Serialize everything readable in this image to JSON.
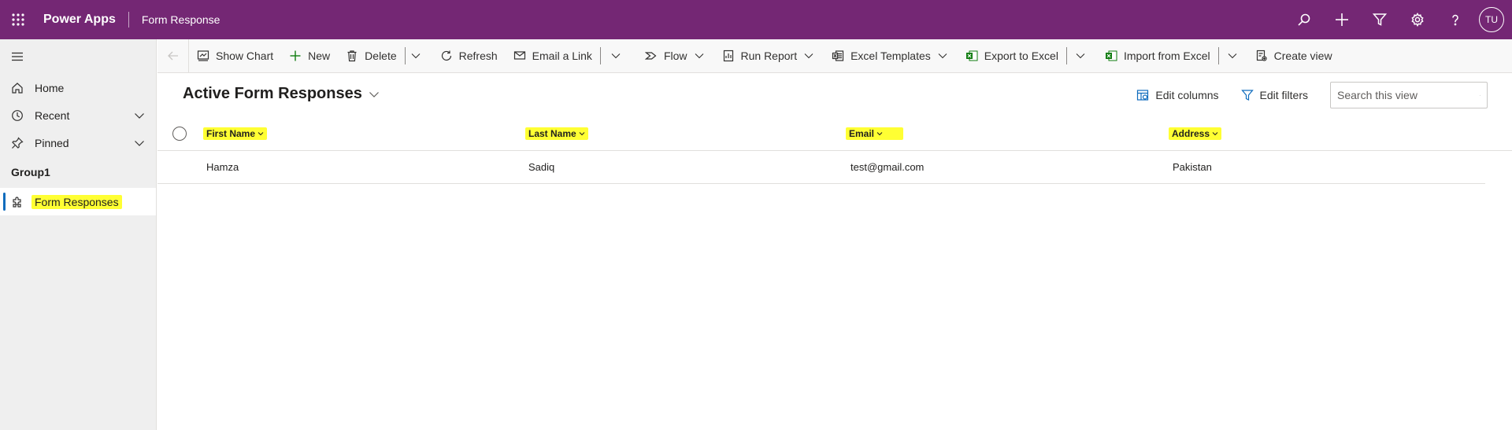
{
  "topbar": {
    "app_name": "Power Apps",
    "page_name": "Form Response",
    "avatar_initials": "TU",
    "icons": [
      "search-icon",
      "add-icon",
      "filter-icon",
      "gear-icon",
      "help-icon"
    ]
  },
  "sidebar": {
    "items": [
      {
        "label": "Home",
        "icon": "home-icon"
      },
      {
        "label": "Recent",
        "icon": "clock-icon"
      },
      {
        "label": "Pinned",
        "icon": "pin-icon"
      }
    ],
    "group_label": "Group1",
    "active_item": {
      "label": "Form Responses",
      "icon": "puzzle-icon"
    }
  },
  "commandbar": {
    "show_chart": "Show Chart",
    "new": "New",
    "delete": "Delete",
    "refresh": "Refresh",
    "email_link": "Email a Link",
    "flow": "Flow",
    "run_report": "Run Report",
    "excel_templates": "Excel Templates",
    "export_excel": "Export to Excel",
    "import_excel": "Import from Excel",
    "create_view": "Create view"
  },
  "view": {
    "title": "Active Form Responses",
    "edit_columns": "Edit columns",
    "edit_filters": "Edit filters",
    "search_placeholder": "Search this view"
  },
  "grid": {
    "columns": [
      "First Name",
      "Last Name",
      "Email",
      "Address"
    ],
    "rows": [
      [
        "Hamza",
        "Sadiq",
        "test@gmail.com",
        "Pakistan"
      ]
    ]
  },
  "colors": {
    "topbar": "#742774",
    "highlight": "#ffff33",
    "active_bar": "#0f6cbd"
  }
}
